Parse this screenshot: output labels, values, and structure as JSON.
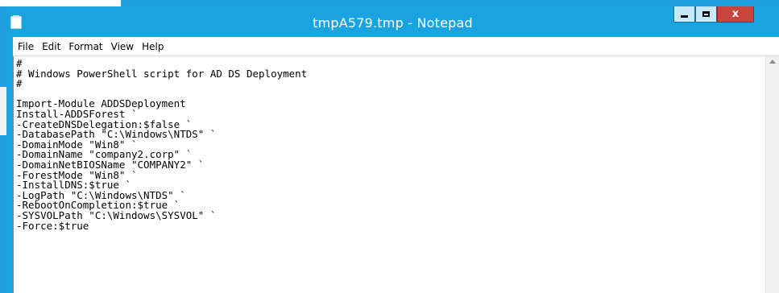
{
  "window": {
    "title": "tmpA579.tmp - Notepad",
    "close_glyph": "x"
  },
  "menu": {
    "items": [
      "File",
      "Edit",
      "Format",
      "View",
      "Help"
    ]
  },
  "document": {
    "lines": [
      "#",
      "# Windows PowerShell script for AD DS Deployment",
      "#",
      "",
      "Import-Module ADDSDeployment",
      "Install-ADDSForest `",
      "-CreateDNSDelegation:$false `",
      "-DatabasePath \"C:\\Windows\\NTDS\" `",
      "-DomainMode \"Win8\" `",
      "-DomainName \"company2.corp\" `",
      "-DomainNetBIOSName \"COMPANY2\" `",
      "-ForestMode \"Win8\" `",
      "-InstallDNS:$true `",
      "-LogPath \"C:\\Windows\\NTDS\" `",
      "-RebootOnCompletion:$true `",
      "-SYSVOLPath \"C:\\Windows\\SYSVOL\" `",
      "-Force:$true"
    ]
  },
  "icons": {
    "app": "notepad-icon",
    "minimize": "minimize-icon",
    "maximize": "maximize-icon",
    "close": "close-icon",
    "scroll_up": "scroll-up-arrow-icon"
  },
  "colors": {
    "titlebar": "#19a3df",
    "close_button": "#c7453b",
    "background": "#1ea0dc"
  }
}
